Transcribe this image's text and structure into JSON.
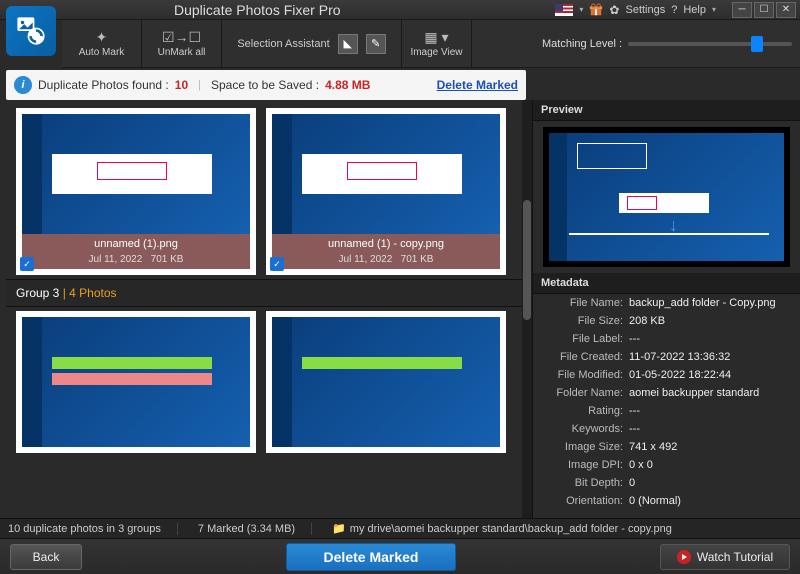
{
  "title": "Duplicate Photos Fixer Pro",
  "titlebar": {
    "settings": "Settings",
    "help": "Help",
    "gear_icon": "gear-icon",
    "help_icon": "help-icon",
    "flag_icon": "us-flag-icon",
    "gift_icon": "gift-icon"
  },
  "toolbar": {
    "auto_mark": "Auto Mark",
    "unmark_all": "UnMark all",
    "selection_assistant": "Selection Assistant",
    "image_view": "Image View"
  },
  "matching": {
    "label": "Matching Level :",
    "value_percent": 78
  },
  "info": {
    "found_label": "Duplicate Photos found :",
    "found_count": "10",
    "space_label": "Space to be Saved :",
    "space_value": "4.88 MB",
    "delete_marked": "Delete Marked"
  },
  "gallery": {
    "group2_items": [
      {
        "name": "unnamed (1).png",
        "date": "Jul 11, 2022",
        "size": "701 KB",
        "checked": true
      },
      {
        "name": "unnamed (1) - copy.png",
        "date": "Jul 11, 2022",
        "size": "701 KB",
        "checked": true
      }
    ],
    "group3_header_a": "Group 3",
    "group3_header_sep": " | ",
    "group3_header_b": "4 Photos"
  },
  "preview": {
    "header": "Preview"
  },
  "metadata": {
    "header": "Metadata",
    "rows": [
      {
        "k": "File Name:",
        "v": "backup_add folder - Copy.png"
      },
      {
        "k": "File Size:",
        "v": "208 KB"
      },
      {
        "k": "File Label:",
        "v": "---"
      },
      {
        "k": "File Created:",
        "v": "11-07-2022 13:36:32"
      },
      {
        "k": "File Modified:",
        "v": "01-05-2022 18:22:44"
      },
      {
        "k": "Folder Name:",
        "v": "aomei backupper standard"
      },
      {
        "k": "Rating:",
        "v": "---"
      },
      {
        "k": "Keywords:",
        "v": "---"
      },
      {
        "k": "Image Size:",
        "v": "741 x 492"
      },
      {
        "k": "Image DPI:",
        "v": "0 x 0"
      },
      {
        "k": "Bit Depth:",
        "v": "0"
      },
      {
        "k": "Orientation:",
        "v": "0 (Normal)"
      }
    ]
  },
  "status": {
    "summary": "10 duplicate photos in 3 groups",
    "marked": "7 Marked (3.34 MB)",
    "path": "my drive\\aomei backupper standard\\backup_add folder - copy.png"
  },
  "bottom": {
    "back": "Back",
    "delete": "Delete Marked",
    "watch": "Watch Tutorial"
  }
}
